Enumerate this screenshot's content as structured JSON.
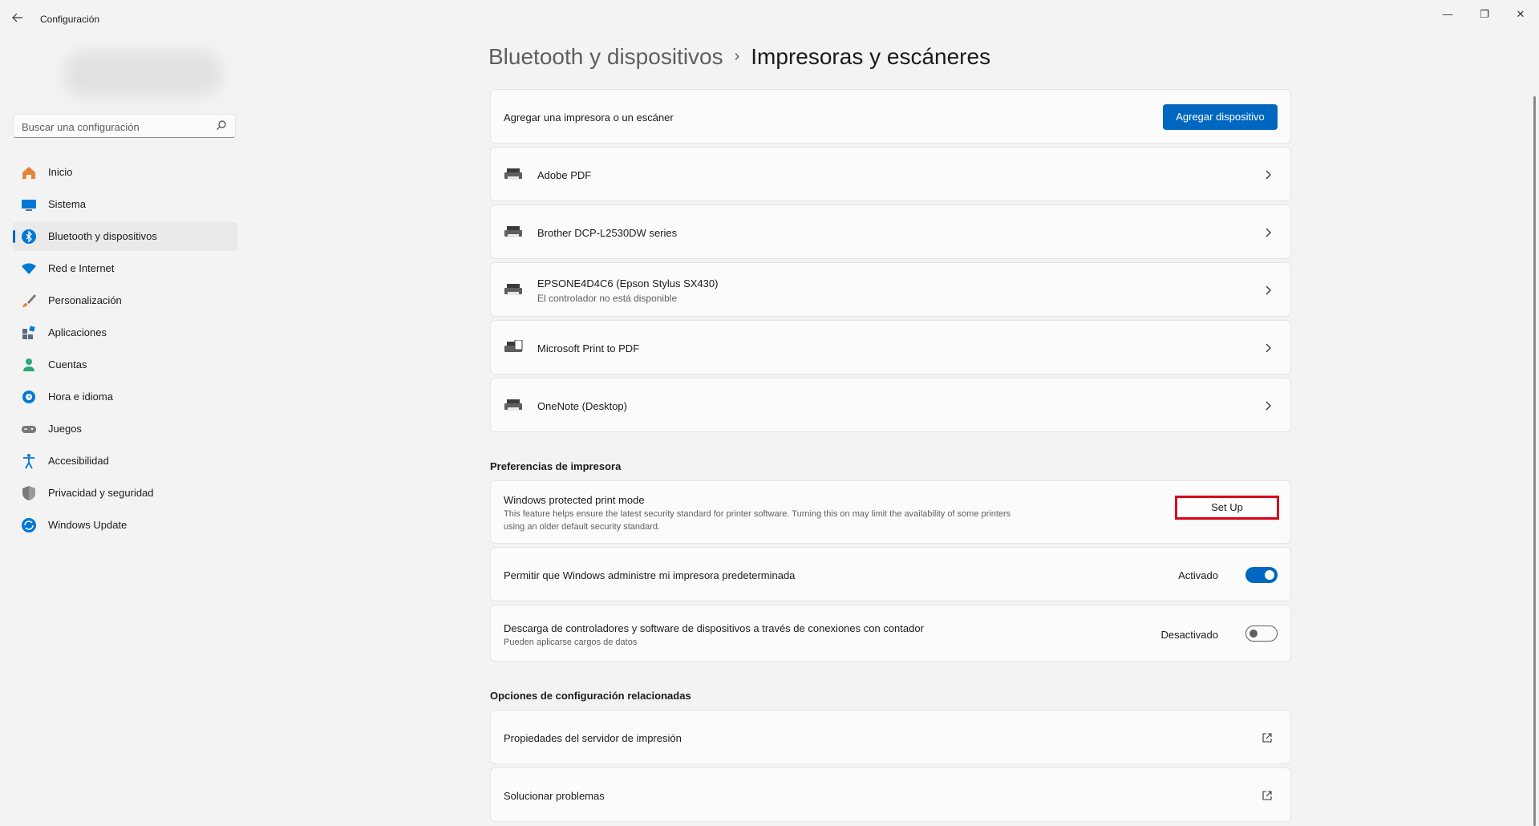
{
  "window": {
    "title": "Configuración",
    "minimize_glyph": "—",
    "maximize_glyph": "❐",
    "close_glyph": "✕"
  },
  "sidebar": {
    "search_placeholder": "Buscar una configuración",
    "items": [
      {
        "label": "Inicio",
        "icon": "home-icon",
        "color": "#e8833a"
      },
      {
        "label": "Sistema",
        "icon": "monitor-icon",
        "color": "#0078d4"
      },
      {
        "label": "Bluetooth y dispositivos",
        "icon": "bluetooth-icon",
        "color": "#0078d4",
        "active": true
      },
      {
        "label": "Red e Internet",
        "icon": "wifi-icon",
        "color": "#0078d4"
      },
      {
        "label": "Personalización",
        "icon": "brush-icon",
        "color": "#e8833a"
      },
      {
        "label": "Aplicaciones",
        "icon": "apps-icon",
        "color": "#5a6b80"
      },
      {
        "label": "Cuentas",
        "icon": "person-icon",
        "color": "#2aa876"
      },
      {
        "label": "Hora e idioma",
        "icon": "globe-clock-icon",
        "color": "#0078d4"
      },
      {
        "label": "Juegos",
        "icon": "gamepad-icon",
        "color": "#7a7a7a"
      },
      {
        "label": "Accesibilidad",
        "icon": "accessibility-icon",
        "color": "#0078d4"
      },
      {
        "label": "Privacidad y seguridad",
        "icon": "shield-icon",
        "color": "#7a7a7a"
      },
      {
        "label": "Windows Update",
        "icon": "update-icon",
        "color": "#0078d4"
      }
    ]
  },
  "breadcrumb": {
    "parent": "Bluetooth y dispositivos",
    "separator": "›",
    "current": "Impresoras y escáneres"
  },
  "add_card": {
    "label": "Agregar una impresora o un escáner",
    "button": "Agregar dispositivo"
  },
  "printers": [
    {
      "name": "Adobe PDF",
      "status": ""
    },
    {
      "name": "Brother DCP-L2530DW series",
      "status": ""
    },
    {
      "name": "EPSONE4D4C6 (Epson Stylus SX430)",
      "status": "El controlador no está disponible"
    },
    {
      "name": "Microsoft Print to PDF",
      "status": ""
    },
    {
      "name": "OneNote (Desktop)",
      "status": ""
    }
  ],
  "preferences": {
    "title": "Preferencias de impresora",
    "protected_mode": {
      "title": "Windows protected print mode",
      "desc_line1": "This feature helps ensure the latest security standard for printer software. Turning this on may limit the availability of some printers",
      "desc_line2": "using an older default security standard.",
      "button": "Set Up"
    },
    "default_printer": {
      "label": "Permitir que Windows administre mi impresora predeterminada",
      "state": "Activado"
    },
    "metered": {
      "label": "Descarga de controladores y software de dispositivos a través de conexiones con contador",
      "sub": "Pueden aplicarse cargos de datos",
      "state": "Desactivado"
    }
  },
  "related": {
    "title": "Opciones de configuración relacionadas",
    "items": [
      {
        "label": "Propiedades del servidor de impresión"
      },
      {
        "label": "Solucionar problemas"
      }
    ]
  }
}
